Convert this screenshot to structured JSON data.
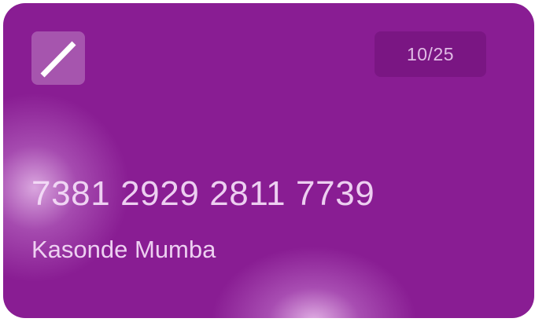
{
  "card": {
    "counter": "10/25",
    "number": "7381 2929 2811 7739",
    "holder_name": "Kasonde Mumba",
    "edit_icon": "pencil-slash-icon",
    "colors": {
      "background": "#891d93",
      "text": "#f5def8"
    }
  }
}
